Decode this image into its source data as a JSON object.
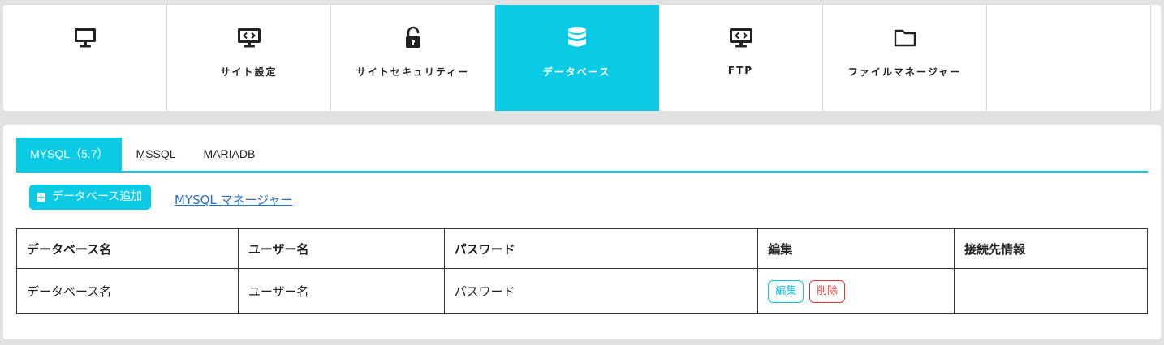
{
  "nav": {
    "tabs": [
      {
        "label": "",
        "icon": "monitor-icon"
      },
      {
        "label": "サイト設定",
        "icon": "code-monitor-icon"
      },
      {
        "label": "サイトセキュリティー",
        "icon": "unlock-icon"
      },
      {
        "label": "データベース",
        "icon": "database-icon"
      },
      {
        "label": "FTP",
        "icon": "code-monitor-icon"
      },
      {
        "label": "ファイルマネージャー",
        "icon": "folder-icon"
      }
    ],
    "active_index": 3
  },
  "db_tabs": [
    "MYSQL（5.7）",
    "MSSQL",
    "MARIADB"
  ],
  "actions": {
    "add_database": "データベース追加",
    "manager_link": "MYSQL マネージャー"
  },
  "table": {
    "headers": [
      "データベース名",
      "ユーザー名",
      "パスワード",
      "編集",
      "接続先情報"
    ],
    "rows": [
      {
        "database": "データベース名",
        "user": "ユーザー名",
        "password": "パスワード",
        "edit_label": "編集",
        "delete_label": "削除",
        "connection": ""
      }
    ]
  },
  "colors": {
    "accent": "#0bcbe4",
    "danger": "#d93a3a",
    "link": "#2a70c9"
  }
}
